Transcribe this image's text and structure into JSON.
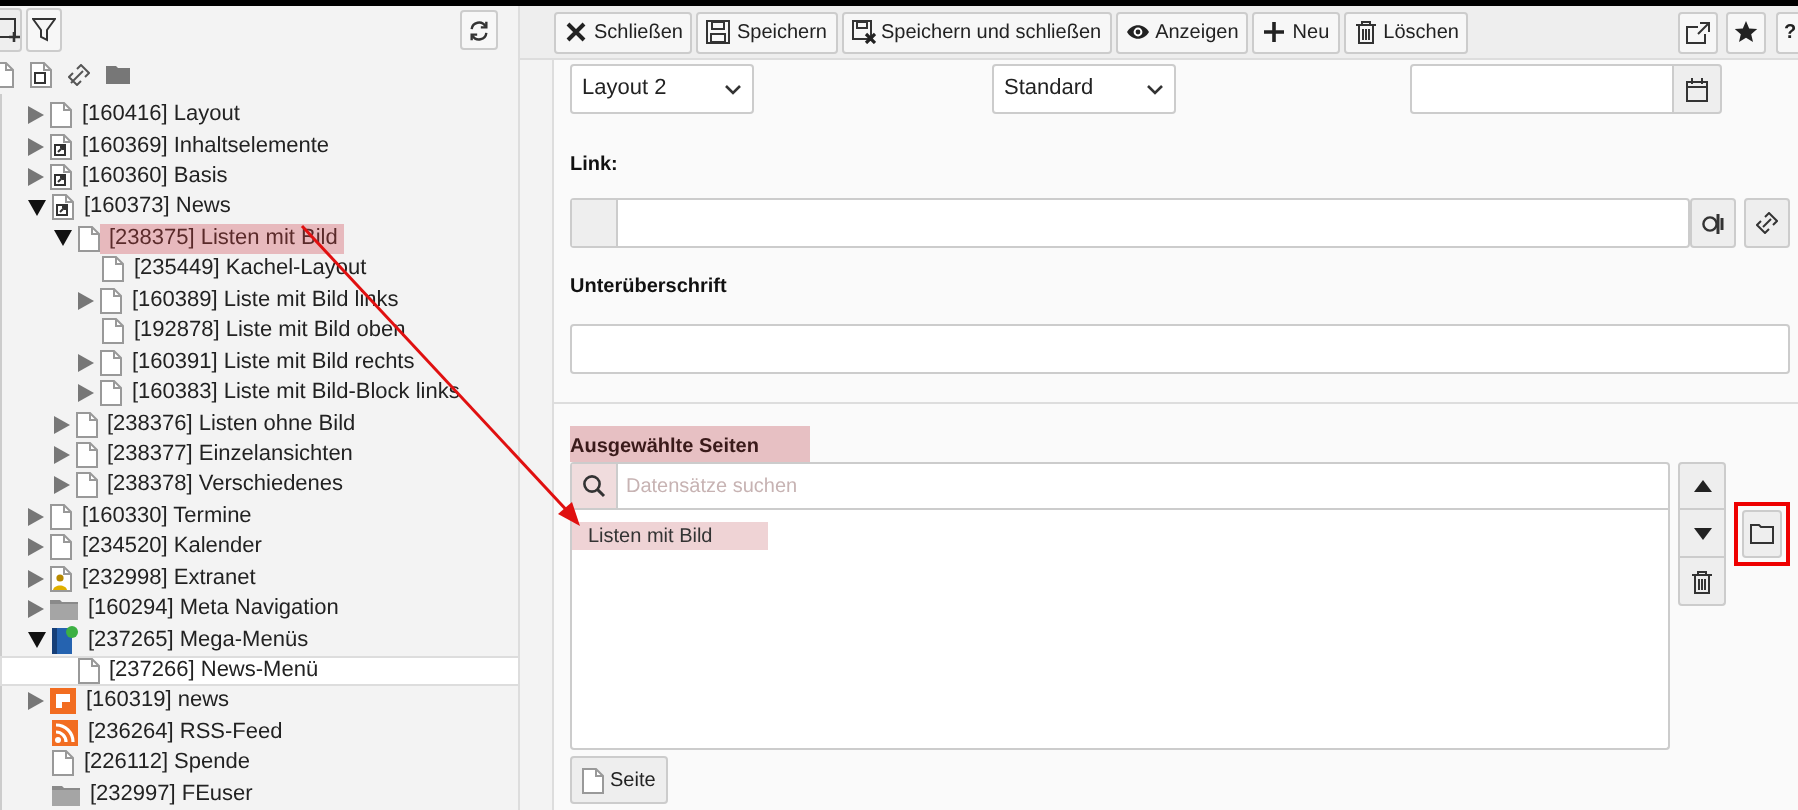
{
  "tree": [
    {
      "label": "[160416] Layout",
      "kind": "page",
      "expanded": false,
      "selected": false,
      "highlighted": false
    },
    {
      "label": "[160369] Inhaltselemente",
      "kind": "shortcut",
      "expanded": false,
      "selected": false,
      "highlighted": false
    },
    {
      "label": "[160360] Basis",
      "kind": "shortcut",
      "expanded": false,
      "selected": false,
      "highlighted": false
    },
    {
      "label": "[160373] News",
      "kind": "shortcut",
      "expanded": true,
      "selected": false,
      "highlighted": false,
      "children": [
        {
          "label": "[238375] Listen mit Bild",
          "kind": "page",
          "expanded": true,
          "selected": false,
          "highlighted": true,
          "children": [
            {
              "label": "[235449] Kachel-Layout",
              "kind": "page",
              "selected": false,
              "highlighted": false
            },
            {
              "label": "[160389] Liste mit Bild links",
              "kind": "page",
              "expanded": false,
              "selected": false,
              "highlighted": false
            },
            {
              "label": "[192878] Liste mit Bild oben",
              "kind": "page",
              "selected": false,
              "highlighted": false
            },
            {
              "label": "[160391] Liste mit Bild rechts",
              "kind": "page",
              "expanded": false,
              "selected": false,
              "highlighted": false
            },
            {
              "label": "[160383] Liste mit Bild-Block links",
              "kind": "page",
              "expanded": false,
              "selected": false,
              "highlighted": false
            }
          ]
        },
        {
          "label": "[238376] Listen ohne Bild",
          "kind": "page",
          "expanded": false,
          "selected": false,
          "highlighted": false
        },
        {
          "label": "[238377] Einzelansichten",
          "kind": "page",
          "expanded": false,
          "selected": false,
          "highlighted": false
        },
        {
          "label": "[238378] Verschiedenes",
          "kind": "page",
          "expanded": false,
          "selected": false,
          "highlighted": false
        }
      ]
    },
    {
      "label": "[160330] Termine",
      "kind": "page",
      "expanded": false,
      "selected": false,
      "highlighted": false
    },
    {
      "label": "[234520] Kalender",
      "kind": "page",
      "expanded": false,
      "selected": false,
      "highlighted": false
    },
    {
      "label": "[232998] Extranet",
      "kind": "extranet",
      "expanded": false,
      "selected": false,
      "highlighted": false
    },
    {
      "label": "[160294] Meta Navigation",
      "kind": "folder",
      "expanded": false,
      "selected": false,
      "highlighted": false
    },
    {
      "label": "[237265] Mega-Menüs",
      "kind": "mega",
      "expanded": true,
      "selected": false,
      "highlighted": false,
      "children": [
        {
          "label": "[237266] News-Menü",
          "kind": "page",
          "selected": true,
          "highlighted": false
        }
      ]
    },
    {
      "label": "[160319] news",
      "kind": "news",
      "expanded": false,
      "selected": false,
      "highlighted": false
    },
    {
      "label": "[236264] RSS-Feed",
      "kind": "rss",
      "selected": false,
      "highlighted": false
    },
    {
      "label": "[226112] Spende",
      "kind": "page",
      "selected": false,
      "highlighted": false
    },
    {
      "label": "[232997] FEuser",
      "kind": "folder",
      "selected": false,
      "highlighted": false
    }
  ],
  "toolbar": [
    {
      "kind": "close",
      "label": "Schließen"
    },
    {
      "kind": "save",
      "label": "Speichern"
    },
    {
      "kind": "save-close",
      "label": "Speichern und schließen"
    },
    {
      "kind": "view",
      "label": "Anzeigen"
    },
    {
      "kind": "new",
      "label": "Neu"
    },
    {
      "kind": "delete",
      "label": "Löschen"
    }
  ],
  "help_button": "?",
  "form": {
    "layout_select": "Layout 2",
    "style_select": "Standard",
    "link_label": "Link:",
    "subtitle_label": "Unterüberschrift",
    "selected_pages": {
      "label": "Ausgewählte Seiten",
      "search_placeholder": "Datensätze suchen",
      "items": [
        "Listen mit Bild"
      ],
      "add_button": "Seite"
    }
  }
}
